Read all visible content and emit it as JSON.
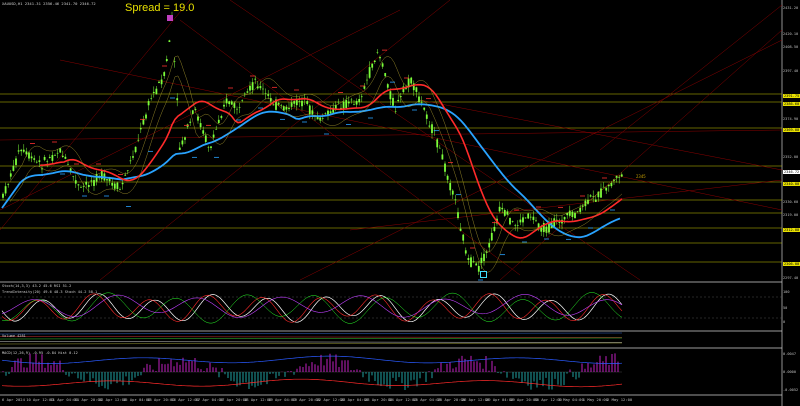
{
  "chart": {
    "symbol_label": "XAUUSD,H1 2341.31 2356.46 2341.70 2346.72",
    "spread_label": "Spread = 19.0",
    "inline_price_label": "2345",
    "osc1_title": "Stoch(14,3,3) 43.2 45.6  RSI 51.2",
    "osc2_title": "TrendIntensity(20) 49.6 48.3  Stoch 44.2 58.1",
    "osc3_title": "Volume 4281",
    "osc4_title": "MACD(12,26,9) -0.95 -0.84  Hist 0.12",
    "colors": {
      "background": "#000000",
      "candle": "#7cff3a",
      "ma_red": "#ff2a2a",
      "ma_blue": "#29a3ff",
      "hline": "#c8c800",
      "trend": "#8b0000",
      "hist": "#c020c0",
      "hist2": "#20a0a0"
    }
  },
  "price_axis": [
    {
      "value": "2431.20",
      "style": "plain"
    },
    {
      "value": "2420.10",
      "style": "plain"
    },
    {
      "value": "2408.50",
      "style": "plain"
    },
    {
      "value": "2397.40",
      "style": "plain"
    },
    {
      "value": "2391.75",
      "style": "box"
    },
    {
      "value": "2386.60",
      "style": "box"
    },
    {
      "value": "2374.90",
      "style": "plain"
    },
    {
      "value": "2369.00",
      "style": "box"
    },
    {
      "value": "2352.00",
      "style": "plain"
    },
    {
      "value": "2346.72",
      "style": "box2"
    },
    {
      "value": "2340.00",
      "style": "box"
    },
    {
      "value": "2330.60",
      "style": "plain"
    },
    {
      "value": "2319.00",
      "style": "plain"
    },
    {
      "value": "2312.00",
      "style": "box"
    },
    {
      "value": "2306.00",
      "style": "box"
    },
    {
      "value": "2297.40",
      "style": "plain"
    }
  ],
  "sub_axis": [
    {
      "value": "100"
    },
    {
      "value": "50"
    },
    {
      "value": "0"
    },
    {
      "value": "0.0047"
    },
    {
      "value": "0.0000"
    },
    {
      "value": "-0.0052"
    }
  ],
  "time_axis": [
    "6 Apr 2024",
    "10 Apr 12:00",
    "11 Apr 04:00",
    "11 Apr 20:00",
    "12 Apr 12:00",
    "15 Apr 04:00",
    "15 Apr 20:00",
    "16 Apr 12:00",
    "17 Apr 04:00",
    "17 Apr 20:00",
    "18 Apr 12:00",
    "19 Apr 04:00",
    "19 Apr 20:00",
    "22 Apr 12:00",
    "23 Apr 04:00",
    "23 Apr 20:00",
    "24 Apr 12:00",
    "25 Apr 04:00",
    "25 Apr 20:00",
    "26 Apr 12:00",
    "29 Apr 04:00",
    "29 Apr 20:00",
    "30 Apr 12:00",
    "1 May 04:00",
    "1 May 20:00",
    "2 May 12:00"
  ]
}
